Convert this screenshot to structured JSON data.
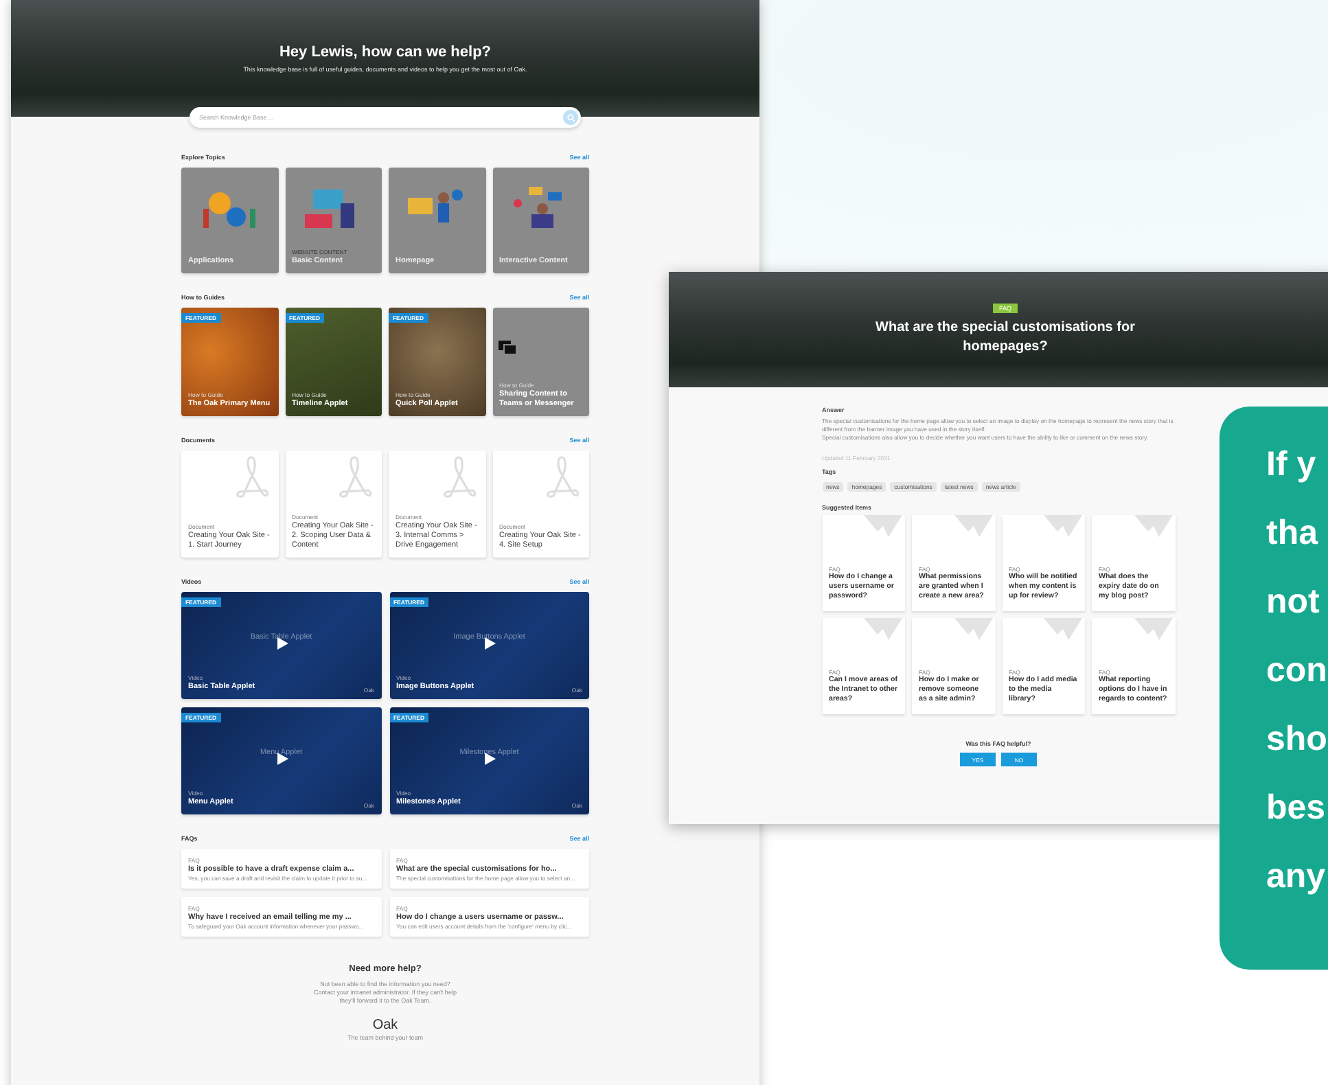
{
  "knowledge_base": {
    "hero": {
      "title": "Hey Lewis, how can we help?",
      "subtitle": "This knowledge base is full of useful guides, documents and videos to help you get the most out of Oak."
    },
    "search": {
      "placeholder": "Search Knowledge Base ..."
    },
    "topics": {
      "heading": "Explore Topics",
      "see_all": "See all",
      "items": [
        {
          "title": "Applications"
        },
        {
          "label": "WEBSITE CONTENT",
          "title": "Basic Content"
        },
        {
          "title": "Homepage"
        },
        {
          "title": "Interactive Content"
        }
      ]
    },
    "guides": {
      "heading": "How to Guides",
      "see_all": "See all",
      "items": [
        {
          "kind": "photo",
          "badge": "FEATURED",
          "label": "How to Guide",
          "title": "The Oak Primary Menu"
        },
        {
          "kind": "photo",
          "badge": "FEATURED",
          "label": "How to Guide",
          "title": "Timeline Applet"
        },
        {
          "kind": "photo",
          "badge": "FEATURED",
          "label": "How to Guide",
          "title": "Quick Poll Applet"
        },
        {
          "kind": "icon",
          "label": "How to Guide",
          "title": "Sharing Content to Teams or Messenger"
        }
      ]
    },
    "documents": {
      "heading": "Documents",
      "see_all": "See all",
      "items": [
        {
          "label": "Document",
          "title": "Creating Your Oak Site - 1. Start Journey"
        },
        {
          "label": "Document",
          "title": "Creating Your Oak Site - 2. Scoping User Data & Content"
        },
        {
          "label": "Document",
          "title": "Creating Your Oak Site - 3. Internal Comms > Drive Engagement"
        },
        {
          "label": "Document",
          "title": "Creating Your Oak Site - 4. Site Setup"
        }
      ]
    },
    "videos": {
      "heading": "Videos",
      "see_all": "See all",
      "items": [
        {
          "badge": "FEATURED",
          "caption": "Basic Table Applet",
          "label": "Video",
          "title": "Basic Table Applet",
          "brand": "Oak"
        },
        {
          "badge": "FEATURED",
          "caption": "Image Buttons Applet",
          "label": "Video",
          "title": "Image Buttons Applet",
          "brand": "Oak"
        },
        {
          "badge": "FEATURED",
          "caption": "Menu Applet",
          "label": "Video",
          "title": "Menu Applet",
          "brand": "Oak"
        },
        {
          "badge": "FEATURED",
          "caption": "Milestones Applet",
          "label": "Video",
          "title": "Milestones Applet",
          "brand": "Oak"
        }
      ]
    },
    "faqs": {
      "heading": "FAQs",
      "see_all": "See all",
      "items": [
        {
          "label": "FAQ",
          "title": "Is it possible to have a draft expense claim a...",
          "snippet": "Yes, you can save a draft and revisit the claim to update it prior to su..."
        },
        {
          "label": "FAQ",
          "title": "What are the special customisations for ho...",
          "snippet": "The special customisations for the home page allow you to select an..."
        },
        {
          "label": "FAQ",
          "title": "Why have I received an email telling me my ...",
          "snippet": "To safeguard your Oak account information whenever your passwo..."
        },
        {
          "label": "FAQ",
          "title": "How do I change a users username or passw...",
          "snippet": "You can edit users account details from the 'configure' menu by clic..."
        }
      ]
    },
    "help": {
      "title": "Need more help?",
      "lines": [
        "Not been able to find the information you need?",
        "Contact your intranet administrator. If they can't help",
        "they'll forward it to the Oak Team."
      ],
      "brand": "Oak",
      "tagline": "The team behind your team"
    }
  },
  "faq_page": {
    "badge": "FAQ",
    "title": "What are the special customisations for homepages?",
    "answer_heading": "Answer",
    "answer": [
      "The special customisations for the home page allow you to select an image to display on the homepage to represent the news story that is different from the banner image you have used in the story itself.",
      "Special customisations also allow you to decide whether you want users to have the ability to like or comment on the news story."
    ],
    "updated": "Updated 11 February 2021",
    "tags_heading": "Tags",
    "tags": [
      "news",
      "homepages",
      "customisations",
      "latest news",
      "news article"
    ],
    "suggested_heading": "Suggested Items",
    "suggested": [
      {
        "label": "FAQ",
        "title": "How do I change a users username or password?"
      },
      {
        "label": "FAQ",
        "title": "What permissions are granted when I create a new area?"
      },
      {
        "label": "FAQ",
        "title": "Who will be notified when my content is up for review?"
      },
      {
        "label": "FAQ",
        "title": "What does the expiry date do on my blog post?"
      },
      {
        "label": "FAQ",
        "title": "Can I move areas of the Intranet to other areas?"
      },
      {
        "label": "FAQ",
        "title": "How do I make or remove someone as a site admin?"
      },
      {
        "label": "FAQ",
        "title": "How do I add media to the media library?"
      },
      {
        "label": "FAQ",
        "title": "What reporting options do I have in regards to content?"
      }
    ],
    "helpful_question": "Was this FAQ helpful?",
    "buttons": [
      "YES",
      "NO"
    ]
  },
  "callout": {
    "lines": [
      "If y",
      "tha",
      "not",
      "con",
      "sho",
      "bes",
      "any"
    ]
  }
}
